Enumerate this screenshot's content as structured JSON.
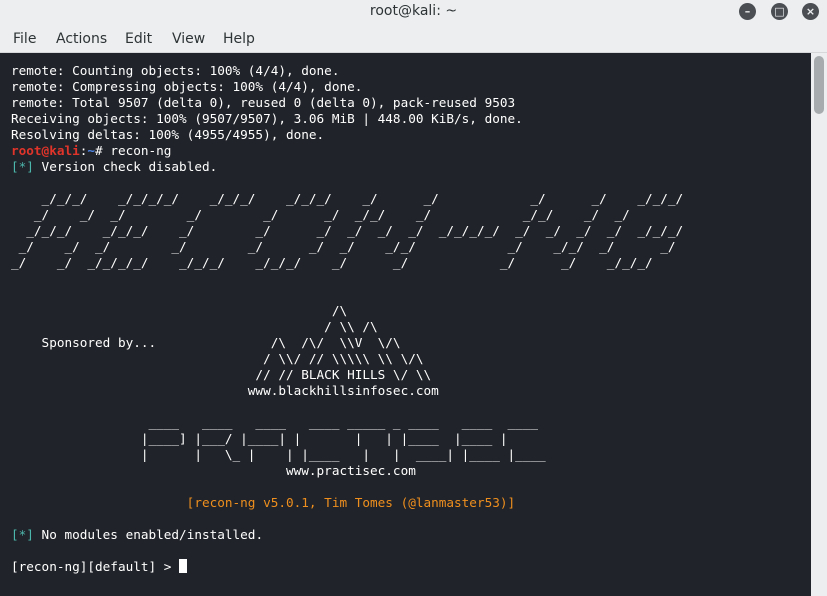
{
  "window": {
    "title": "root@kali: ~",
    "minimize_glyph": "–",
    "maximize_glyph": "□",
    "close_glyph": "×"
  },
  "menubar": {
    "file": "File",
    "actions": "Actions",
    "edit": "Edit",
    "view": "View",
    "help": "Help"
  },
  "terminal": {
    "git_lines": [
      "remote: Counting objects: 100% (4/4), done.",
      "remote: Compressing objects: 100% (4/4), done.",
      "remote: Total 9507 (delta 0), reused 0 (delta 0), pack-reused 9503",
      "Receiving objects: 100% (9507/9507), 3.06 MiB | 448.00 KiB/s, done.",
      "Resolving deltas: 100% (4955/4955), done."
    ],
    "prompt": {
      "user_host": "root@kali",
      "colon": ":",
      "path": "~",
      "symbol": "# ",
      "command": "recon-ng"
    },
    "status_tag": "[*]",
    "version_check": " Version check disabled.",
    "banner_art": [
      "",
      "    _/_/_/    _/_/_/_/    _/_/_/    _/_/_/    _/      _/            _/      _/    _/_/_/",
      "   _/    _/  _/        _/        _/      _/  _/_/    _/            _/_/    _/  _/       ",
      "  _/_/_/    _/_/_/    _/        _/      _/  _/  _/  _/  _/_/_/_/  _/  _/  _/  _/  _/_/_/",
      " _/    _/  _/        _/        _/      _/  _/    _/_/            _/    _/_/  _/      _/ ",
      "_/    _/  _/_/_/_/    _/_/_/    _/_/_/    _/      _/            _/      _/    _/_/_/    ",
      "",
      "",
      "                                          /\\",
      "                                         / \\\\ /\\",
      "    Sponsored by...               /\\  /\\/  \\\\V  \\/\\",
      "                                 / \\\\/ // \\\\\\\\\\ \\\\ \\/\\",
      "                                // // BLACK HILLS \\/ \\\\",
      "                               www.blackhillsinfosec.com",
      "",
      "                  ____   ____   ____   ____ _____ _ ____   ____  ____",
      "                 |____] |___/ |____| |       |   | |____  |____ |",
      "                 |      |   \\_ |    | |____   |   |  ____| |____ |____",
      "                                    www.practisec.com",
      ""
    ],
    "version_banner": "                       [recon-ng v5.0.1, Tim Tomes (@lanmaster53)]",
    "modules_msg": " No modules enabled/installed.",
    "final_prompt": "[recon-ng][default] > "
  },
  "colors": {
    "terminal_bg": "#202329",
    "prompt_user": "#e0342a",
    "prompt_path": "#4f86e8",
    "status_tag": "#4db6ac",
    "version_banner": "#ef8f1e",
    "chrome_bg": "#eceeef"
  }
}
